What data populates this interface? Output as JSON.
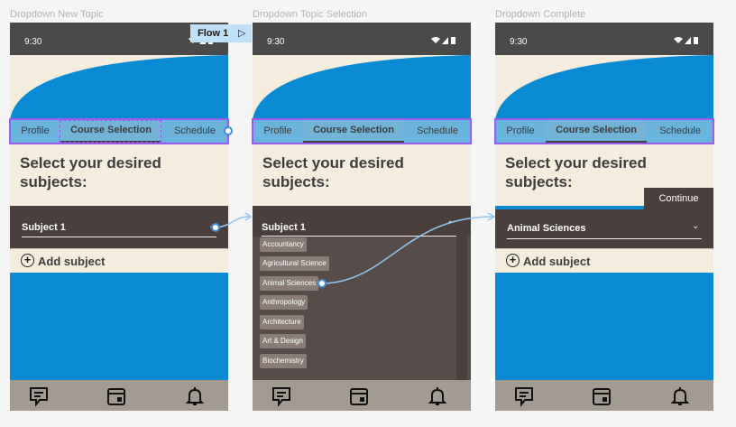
{
  "frames": [
    {
      "label": "Dropdown New Topic",
      "status_time": "9:30",
      "tabs": [
        "Profile",
        "Course Selection",
        "Schedule"
      ],
      "heading": "Select your desired subjects:",
      "subject_label": "Subject 1",
      "add_label": "Add subject"
    },
    {
      "label": "Dropdown Topic Selection",
      "status_time": "9:30",
      "tabs": [
        "Profile",
        "Course Selection",
        "Schedule"
      ],
      "heading": "Select your desired subjects:",
      "subject_label": "Subject 1",
      "options": [
        "Accountancy",
        "Agricultural Science",
        "Animal Sciences",
        "Anthropology",
        "Architecture",
        "Art & Design",
        "Biochemistry"
      ]
    },
    {
      "label": "Dropdown Complete",
      "status_time": "9:30",
      "tabs": [
        "Profile",
        "Course Selection",
        "Schedule"
      ],
      "heading": "Select your desired subjects:",
      "continue_label": "Continue",
      "subject_label": "Animal Sciences",
      "add_label": "Add subject"
    }
  ],
  "flow_badge": {
    "label": "Flow 1",
    "icon": "play-icon"
  },
  "icons": [
    "comment-icon",
    "calendar-icon",
    "bell-icon",
    "chevron-down-icon",
    "chevron-up-icon",
    "add-circle-icon",
    "wifi-icon",
    "signal-icon",
    "battery-icon"
  ],
  "colors": {
    "app_blue": "#0b8ad4",
    "cream": "#f4ecdc",
    "dark_brown": "#4b3f3d",
    "tab_blue": "#6ab3dc",
    "nav_taupe": "#a39a92",
    "selection_purple": "#9b5cf0",
    "flow_blue": "#3d8fd9"
  }
}
